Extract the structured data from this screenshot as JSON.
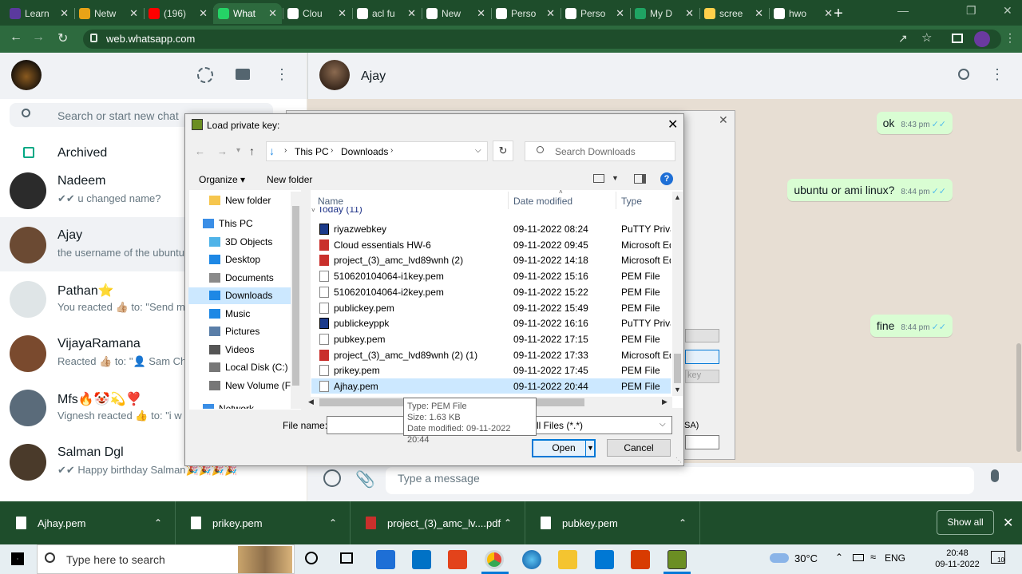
{
  "browser": {
    "tabs": [
      {
        "label": "Learn",
        "color": "#5b3a9e",
        "active": false
      },
      {
        "label": "Netw",
        "color": "#e8a317",
        "active": false
      },
      {
        "label": "(196)",
        "color": "#ff0000",
        "active": false
      },
      {
        "label": "What",
        "color": "#25d366",
        "active": true
      },
      {
        "label": "Clou",
        "color": "#ffffff",
        "active": false
      },
      {
        "label": "acl fu",
        "color": "#ffffff",
        "active": false
      },
      {
        "label": "New",
        "color": "#ffffff",
        "active": false
      },
      {
        "label": "Perso",
        "color": "#ffffff",
        "active": false
      },
      {
        "label": "Perso",
        "color": "#ffffff",
        "active": false
      },
      {
        "label": "My D",
        "color": "#1fa463",
        "active": false
      },
      {
        "label": "scree",
        "color": "#ffd04b",
        "active": false
      },
      {
        "label": "hwo",
        "color": "#ffffff",
        "active": false
      }
    ],
    "url": "web.whatsapp.com",
    "profile_initial": "●"
  },
  "whatsapp": {
    "search_placeholder": "Search or start new chat",
    "archived_label": "Archived",
    "chats": [
      {
        "name": "Nadeem",
        "preview": "✔✔ u changed name?",
        "avatar_color": "#2b2b2b"
      },
      {
        "name": "Ajay",
        "preview": "the username of the ubuntu",
        "avatar_color": "#6b4a33"
      },
      {
        "name": "Pathan⭐",
        "preview": "You reacted 👍🏼 to: \"Send m",
        "avatar_color": "#dfe5e7"
      },
      {
        "name": "VijayaRamana",
        "preview": "Reacted 👍🏼 to: \"👤 Sam Chr",
        "avatar_color": "#7a4a2e"
      },
      {
        "name": "Mfs🔥🤡💫❣️",
        "preview": "Vignesh reacted 👍 to: \"i w",
        "avatar_color": "#5a6b7a"
      },
      {
        "name": "Salman Dgl",
        "preview": "✔✔ Happy birthday Salman🎉🎉🎉🎉",
        "avatar_color": "#4a3a2a"
      }
    ],
    "contact_name": "Ajay",
    "messages": [
      {
        "text": "ok",
        "time": "8:43 pm"
      },
      {
        "text": "ubuntu or ami linux?",
        "time": "8:44 pm"
      },
      {
        "text": "fine",
        "time": "8:44 pm"
      }
    ],
    "message_placeholder": "Type a message"
  },
  "dialog": {
    "title": "Load private key:",
    "breadcrumb": [
      "This PC",
      "Downloads"
    ],
    "search_placeholder": "Search Downloads",
    "organize_label": "Organize ▾",
    "new_folder_label": "New folder",
    "nav_items": [
      {
        "label": "New folder",
        "icon": "folder-icon"
      },
      {
        "label": "This PC",
        "icon": "pc-icon"
      },
      {
        "label": "3D Objects",
        "icon": "cube-icon"
      },
      {
        "label": "Desktop",
        "icon": "desktop-icon"
      },
      {
        "label": "Documents",
        "icon": "documents-icon"
      },
      {
        "label": "Downloads",
        "icon": "download-icon"
      },
      {
        "label": "Music",
        "icon": "music-icon"
      },
      {
        "label": "Pictures",
        "icon": "pictures-icon"
      },
      {
        "label": "Videos",
        "icon": "videos-icon"
      },
      {
        "label": "Local Disk (C:)",
        "icon": "disk-icon"
      },
      {
        "label": "New Volume (F:)",
        "icon": "disk-icon"
      },
      {
        "label": "Network",
        "icon": "network-icon"
      }
    ],
    "columns": {
      "name": "Name",
      "date": "Date modified",
      "type": "Type"
    },
    "group_label": "Today (11)",
    "files": [
      {
        "name": "riyazwebkey",
        "date": "09-11-2022 08:24",
        "type": "PuTTY Private",
        "icon": "putty"
      },
      {
        "name": "Cloud essentials HW-6",
        "date": "09-11-2022 09:45",
        "type": "Microsoft Ed",
        "icon": "pdf"
      },
      {
        "name": "project_(3)_amc_lvd89wnh (2)",
        "date": "09-11-2022 14:18",
        "type": "Microsoft Ed",
        "icon": "pdf"
      },
      {
        "name": "510620104064-i1key.pem",
        "date": "09-11-2022 15:16",
        "type": "PEM File",
        "icon": "file"
      },
      {
        "name": "510620104064-i2key.pem",
        "date": "09-11-2022 15:22",
        "type": "PEM File",
        "icon": "file"
      },
      {
        "name": "publickey.pem",
        "date": "09-11-2022 15:49",
        "type": "PEM File",
        "icon": "file"
      },
      {
        "name": "publickeyppk",
        "date": "09-11-2022 16:16",
        "type": "PuTTY Private",
        "icon": "putty"
      },
      {
        "name": "pubkey.pem",
        "date": "09-11-2022 17:15",
        "type": "PEM File",
        "icon": "file"
      },
      {
        "name": "project_(3)_amc_lvd89wnh (2) (1)",
        "date": "09-11-2022 17:33",
        "type": "Microsoft Ed",
        "icon": "pdf"
      },
      {
        "name": "prikey.pem",
        "date": "09-11-2022 17:45",
        "type": "PEM File",
        "icon": "file"
      },
      {
        "name": "Ajhay.pem",
        "date": "09-11-2022 20:44",
        "type": "PEM File",
        "icon": "file",
        "selected": true
      }
    ],
    "tooltip": {
      "type": "Type: PEM File",
      "size": "Size: 1.63 KB",
      "date": "Date modified: 09-11-2022 20:44"
    },
    "file_name_label": "File name:",
    "file_name_value": "",
    "file_type_value": "ll Files (*.*)",
    "open_label": "Open",
    "cancel_label": "Cancel",
    "background_fragments": {
      "key_label": "key",
      "sa_label": "SA)"
    }
  },
  "downloads": {
    "items": [
      {
        "label": "Ajhay.pem",
        "icon": "file"
      },
      {
        "label": "prikey.pem",
        "icon": "file"
      },
      {
        "label": "project_(3)_amc_lv....pdf",
        "icon": "pdf"
      },
      {
        "label": "pubkey.pem",
        "icon": "file"
      }
    ],
    "show_all": "Show all"
  },
  "taskbar": {
    "search_placeholder": "Type here to search",
    "weather": "30°C",
    "language": "ENG",
    "time": "20:48",
    "date": "09-11-2022",
    "notification_count": "10"
  }
}
